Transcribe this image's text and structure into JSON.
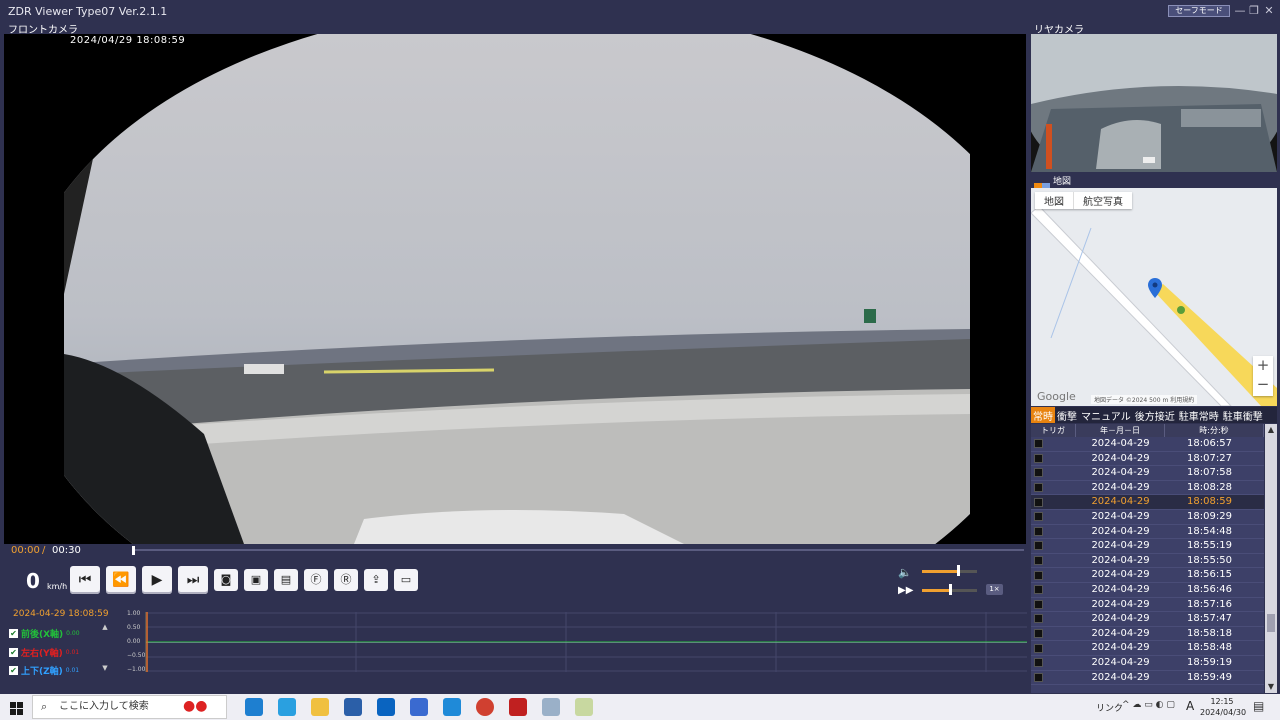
{
  "window": {
    "title": "ZDR Viewer Type07 Ver.2.1.1",
    "safe_mode": "セーフモード",
    "minimize": "—",
    "restore": "❐",
    "close": "✕"
  },
  "front_camera": {
    "label": "フロントカメラ",
    "timestamp": "2024/04/29   18:08:59"
  },
  "rear_camera": {
    "label": "リヤカメラ"
  },
  "map": {
    "label": "地図",
    "tab_map": "地図",
    "tab_aerial": "航空写真",
    "zoom_in": "+",
    "zoom_out": "−",
    "google": "Google",
    "attribution": "地図データ ©2024   500 m            利用規約"
  },
  "categories": [
    "常時",
    "衝撃",
    "マニュアル",
    "後方接近",
    "駐車常時",
    "駐車衝撃"
  ],
  "list_header": {
    "trigger": "トリガ",
    "date": "年－月－日",
    "time": "時:分:秒"
  },
  "files": [
    {
      "date": "2024-04-29",
      "time": "18:06:57"
    },
    {
      "date": "2024-04-29",
      "time": "18:07:27"
    },
    {
      "date": "2024-04-29",
      "time": "18:07:58"
    },
    {
      "date": "2024-04-29",
      "time": "18:08:28"
    },
    {
      "date": "2024-04-29",
      "time": "18:08:59",
      "selected": true
    },
    {
      "date": "2024-04-29",
      "time": "18:09:29"
    },
    {
      "date": "2024-04-29",
      "time": "18:54:48"
    },
    {
      "date": "2024-04-29",
      "time": "18:55:19"
    },
    {
      "date": "2024-04-29",
      "time": "18:55:50"
    },
    {
      "date": "2024-04-29",
      "time": "18:56:15"
    },
    {
      "date": "2024-04-29",
      "time": "18:56:46"
    },
    {
      "date": "2024-04-29",
      "time": "18:57:16"
    },
    {
      "date": "2024-04-29",
      "time": "18:57:47"
    },
    {
      "date": "2024-04-29",
      "time": "18:58:18"
    },
    {
      "date": "2024-04-29",
      "time": "18:58:48"
    },
    {
      "date": "2024-04-29",
      "time": "18:59:19"
    },
    {
      "date": "2024-04-29",
      "time": "18:59:49"
    }
  ],
  "playback": {
    "current": "00:00",
    "separator": "/",
    "total": "00:30",
    "progress": 0,
    "speed": "0",
    "speed_unit": "km/h",
    "volume": 0.65,
    "playback_rate_level": 0.5,
    "rate_label": "1×"
  },
  "sensor": {
    "timestamp": "2024-04-29 18:08:59",
    "axes": [
      {
        "label": "前後(X軸)",
        "value": "0.00",
        "color": "#22c03a"
      },
      {
        "label": "左右(Y軸)",
        "value": "0.01",
        "color": "#e02020"
      },
      {
        "label": "上下(Z軸)",
        "value": "0.01",
        "color": "#30a0ff"
      }
    ],
    "yticks": [
      "1.00",
      "0.50",
      "0.00",
      "−0.50",
      "−1.00"
    ]
  },
  "taskbar": {
    "search_placeholder": "ここに入力して検索",
    "link": "リンク",
    "ime": "A",
    "time": "12:15",
    "date": "2024/04/30"
  }
}
